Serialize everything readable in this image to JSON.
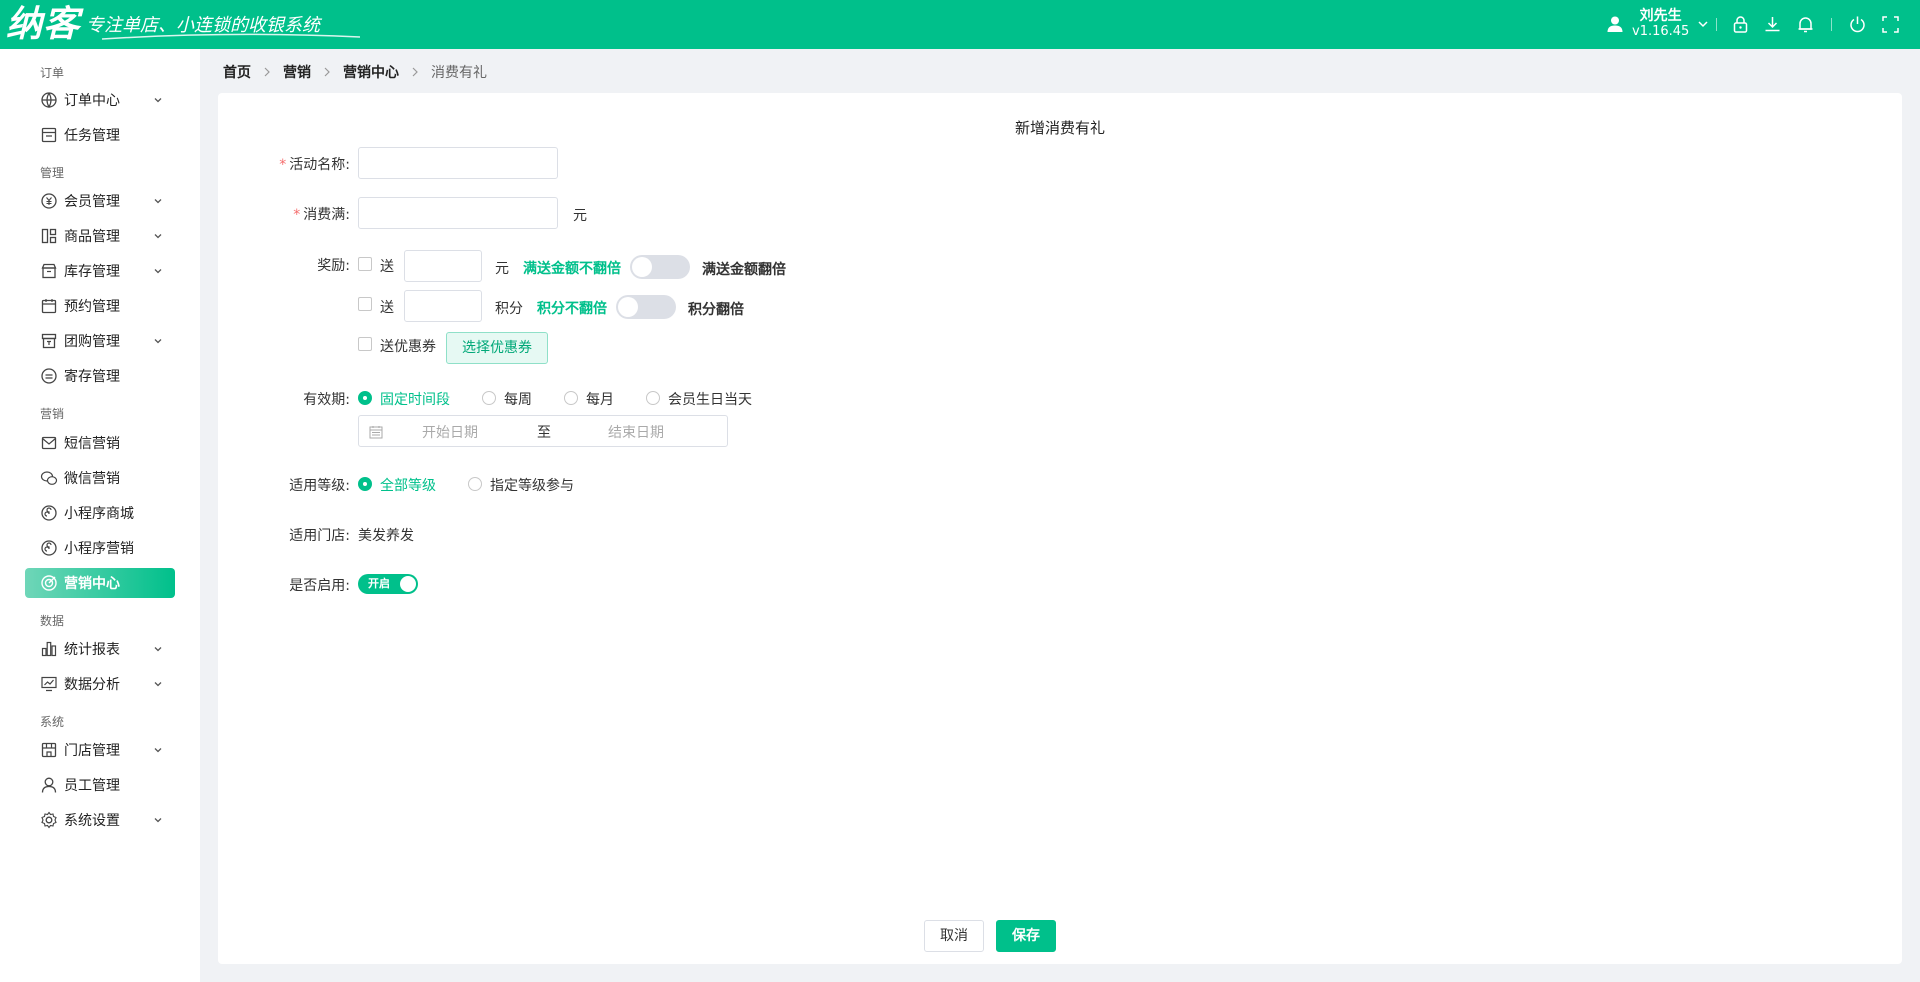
{
  "header": {
    "logo": "纳客",
    "slogan": "专注单店、小连锁的收银系统",
    "user_name": "刘先生",
    "version": "v1.16.45",
    "bg_color": "#00c08b",
    "icons": [
      "lock-icon",
      "download-icon",
      "bell-icon",
      "power-icon",
      "fullscreen-icon"
    ]
  },
  "sidebar": {
    "groups": {
      "order": "订单",
      "manage": "管理",
      "marketing": "营销",
      "data": "数据",
      "system": "系统"
    },
    "items": [
      {
        "label": "订单中心",
        "icon": "globe-icon",
        "expandable": true
      },
      {
        "label": "任务管理",
        "icon": "task-icon",
        "expandable": false
      },
      {
        "label": "会员管理",
        "icon": "member-icon",
        "expandable": true
      },
      {
        "label": "商品管理",
        "icon": "goods-icon",
        "expandable": true
      },
      {
        "label": "库存管理",
        "icon": "inventory-icon",
        "expandable": true
      },
      {
        "label": "预约管理",
        "icon": "calendar-icon",
        "expandable": false
      },
      {
        "label": "团购管理",
        "icon": "group-buy-icon",
        "expandable": true
      },
      {
        "label": "寄存管理",
        "icon": "deposit-icon",
        "expandable": false
      },
      {
        "label": "短信营销",
        "icon": "sms-icon",
        "expandable": false
      },
      {
        "label": "微信营销",
        "icon": "wechat-icon",
        "expandable": false
      },
      {
        "label": "小程序商城",
        "icon": "mini-program-icon",
        "expandable": false
      },
      {
        "label": "小程序营销",
        "icon": "mini-program-icon",
        "expandable": false
      },
      {
        "label": "营销中心",
        "icon": "target-icon",
        "expandable": false,
        "active": true
      },
      {
        "label": "统计报表",
        "icon": "bar-chart-icon",
        "expandable": true
      },
      {
        "label": "数据分析",
        "icon": "monitor-chart-icon",
        "expandable": true
      },
      {
        "label": "门店管理",
        "icon": "store-icon",
        "expandable": true
      },
      {
        "label": "员工管理",
        "icon": "staff-icon",
        "expandable": false
      },
      {
        "label": "系统设置",
        "icon": "gear-icon",
        "expandable": true
      }
    ]
  },
  "breadcrumb": [
    "首页",
    "营销",
    "营销中心",
    "消费有礼"
  ],
  "form": {
    "title": "新增消费有礼",
    "activity_name": {
      "label": "活动名称:",
      "value": ""
    },
    "min_spend": {
      "label": "消费满:",
      "value": "",
      "unit": "元"
    },
    "reward": {
      "label": "奖励:",
      "cash": {
        "prefix": "送",
        "value": "",
        "unit": "元",
        "multiplier_off": "满送金额不翻倍",
        "multiplier_on": "满送金额翻倍",
        "checked": false,
        "switch_on": false
      },
      "points": {
        "prefix": "送",
        "value": "",
        "unit": "积分",
        "multiplier_off": "积分不翻倍",
        "multiplier_on": "积分翻倍",
        "checked": false,
        "switch_on": false
      },
      "coupon": {
        "label": "送优惠券",
        "button": "选择优惠券",
        "checked": false
      }
    },
    "validity": {
      "label": "有效期:",
      "options": [
        "固定时间段",
        "每周",
        "每月",
        "会员生日当天"
      ],
      "selected": "固定时间段",
      "start_placeholder": "开始日期",
      "separator": "至",
      "end_placeholder": "结束日期"
    },
    "level": {
      "label": "适用等级:",
      "options": [
        "全部等级",
        "指定等级参与"
      ],
      "selected": "全部等级"
    },
    "store": {
      "label": "适用门店:",
      "value": "美发养发"
    },
    "enabled": {
      "label": "是否启用:",
      "switch_text": "开启",
      "value": true
    }
  },
  "actions": {
    "cancel": "取消",
    "save": "保存"
  },
  "colors": {
    "accent": "#00c08b",
    "required": "#f56c6c"
  }
}
